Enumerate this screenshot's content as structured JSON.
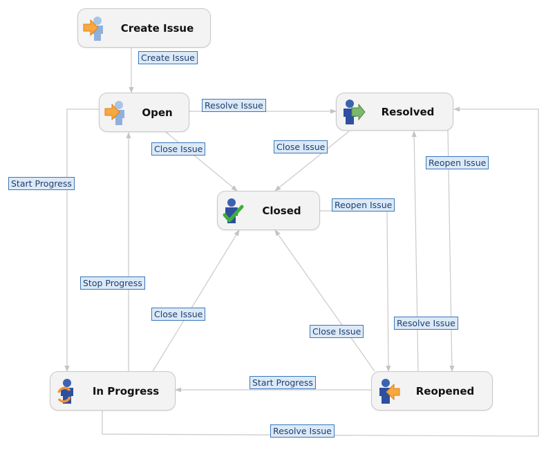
{
  "diagram": {
    "type": "workflow",
    "nodes": [
      {
        "id": "create",
        "label": "Create Issue",
        "icon": "create-issue-icon"
      },
      {
        "id": "open",
        "label": "Open",
        "icon": "open-issue-icon"
      },
      {
        "id": "resolved",
        "label": "Resolved",
        "icon": "resolved-issue-icon"
      },
      {
        "id": "closed",
        "label": "Closed",
        "icon": "closed-issue-icon"
      },
      {
        "id": "inprogress",
        "label": "In Progress",
        "icon": "in-progress-issue-icon"
      },
      {
        "id": "reopened",
        "label": "Reopened",
        "icon": "reopened-issue-icon"
      }
    ],
    "transitions": [
      {
        "label": "Create Issue",
        "from": "create",
        "to": "open"
      },
      {
        "label": "Resolve Issue",
        "from": "open",
        "to": "resolved"
      },
      {
        "label": "Close Issue",
        "from": "open",
        "to": "closed"
      },
      {
        "label": "Close Issue",
        "from": "resolved",
        "to": "closed"
      },
      {
        "label": "Start Progress",
        "from": "open",
        "to": "inprogress"
      },
      {
        "label": "Reopen Issue",
        "from": "resolved",
        "to": "reopened"
      },
      {
        "label": "Reopen Issue",
        "from": "closed",
        "to": "reopened"
      },
      {
        "label": "Stop Progress",
        "from": "inprogress",
        "to": "open"
      },
      {
        "label": "Close Issue",
        "from": "inprogress",
        "to": "closed"
      },
      {
        "label": "Close Issue",
        "from": "reopened",
        "to": "closed"
      },
      {
        "label": "Resolve Issue",
        "from": "reopened",
        "to": "resolved"
      },
      {
        "label": "Start Progress",
        "from": "reopened",
        "to": "inprogress"
      },
      {
        "label": "Resolve Issue",
        "from": "inprogress",
        "to": "resolved"
      }
    ]
  }
}
